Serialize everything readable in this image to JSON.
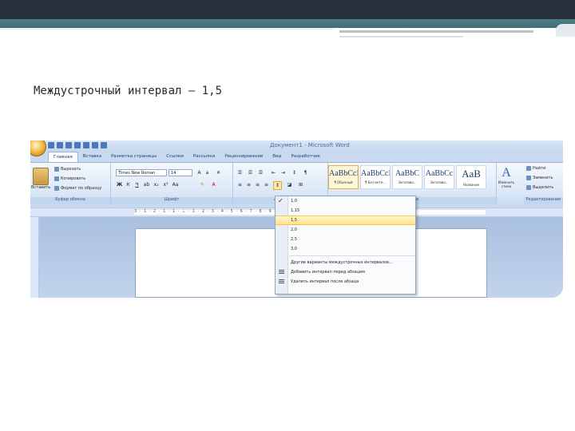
{
  "slide": {
    "title": "Междустрочный интервал – 1,5"
  },
  "word": {
    "window_title": "Документ1 - Microsoft Word",
    "tabs": [
      "Главная",
      "Вставка",
      "Разметка страницы",
      "Ссылки",
      "Рассылки",
      "Рецензирование",
      "Вид",
      "Разработчик"
    ],
    "clipboard": {
      "paste_label": "Вставить",
      "cut_label": "Вырезать",
      "copy_label": "Копировать",
      "format_painter_label": "Формат по образцу",
      "group_label": "Буфер обмена"
    },
    "font": {
      "font_name": "Times New Roman",
      "font_size": "14",
      "group_label": "Шрифт"
    },
    "paragraph": {
      "group_label": "Абзац"
    },
    "styles": {
      "items": [
        {
          "sample": "AaBbCcI",
          "name": "¶ Обычный"
        },
        {
          "sample": "AaBbCcI",
          "name": "¶ Без инте..."
        },
        {
          "sample": "AaBbC",
          "name": "Заголово..."
        },
        {
          "sample": "AaBbCc",
          "name": "Заголово..."
        },
        {
          "sample": "AaB",
          "name": "Название"
        }
      ],
      "change_styles_label": "Изменить стили",
      "group_label": "Стили"
    },
    "editing": {
      "find_label": "Найти",
      "replace_label": "Заменить",
      "select_label": "Выделить",
      "group_label": "Редактирование"
    },
    "line_spacing_menu": {
      "options": [
        "1,0",
        "1,15",
        "1,5",
        "2,0",
        "2,5",
        "3,0"
      ],
      "checked_option": "1,0",
      "highlighted_option": "1,5",
      "more_options_label": "Другие варианты междустрочных интервалов...",
      "add_space_before_label": "Добавить интервал перед абзацем",
      "remove_space_after_label": "Удалить интервал после абзаца"
    },
    "ruler_numbers": "3 · 1 · 2 · 1 · 1 · ⊥ · 1 · 2 · 3 · 4 · 5 · 6 · 7 · 8 · 9 · 10 · 11 · 12 · 13 · 14 · 15 · 16 · △ · 17"
  },
  "colors": {
    "topbar": "#27323c",
    "accent": "#3f6f79",
    "ribbon": "#dbe8f7",
    "highlight": "#ffe28a"
  }
}
